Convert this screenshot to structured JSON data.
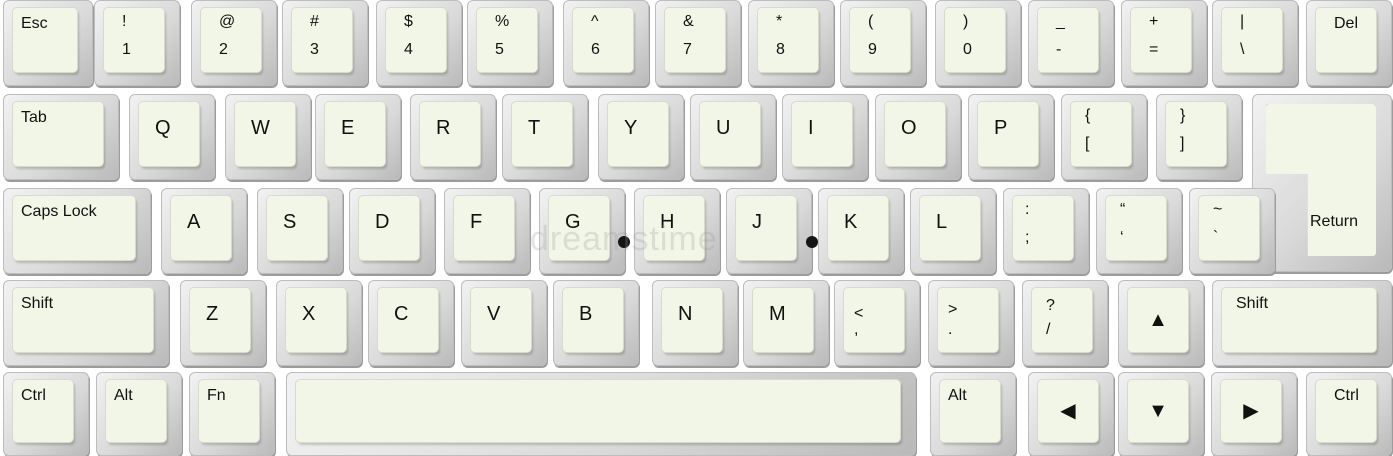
{
  "keys": {
    "esc": "Esc",
    "n1_top": "!",
    "n1_bot": "1",
    "n2_top": "@",
    "n2_bot": "2",
    "n3_top": "#",
    "n3_bot": "3",
    "n4_top": "$",
    "n4_bot": "4",
    "n5_top": "%",
    "n5_bot": "5",
    "n6_top": "^",
    "n6_bot": "6",
    "n7_top": "&",
    "n7_bot": "7",
    "n8_top": "*",
    "n8_bot": "8",
    "n9_top": "(",
    "n9_bot": "9",
    "n0_top": ")",
    "n0_bot": "0",
    "minus_top": "_",
    "minus_bot": "-",
    "equal_top": "+",
    "equal_bot": "=",
    "pipe_top": "|",
    "pipe_bot": "\\",
    "del": "Del",
    "tab": "Tab",
    "q": "Q",
    "w": "W",
    "e": "E",
    "r": "R",
    "t": "T",
    "y": "Y",
    "u": "U",
    "i": "I",
    "o": "O",
    "p": "P",
    "lbrace_top": "{",
    "lbrace_bot": "[",
    "rbrace_top": "}",
    "rbrace_bot": "]",
    "return": "Return",
    "caps": "Caps Lock",
    "a": "A",
    "s": "S",
    "d": "D",
    "f": "F",
    "g": "G",
    "h": "H",
    "j": "J",
    "k": "K",
    "l": "L",
    "semi_top": ":",
    "semi_bot": ";",
    "quote_top": "“",
    "quote_bot": "‘",
    "tilde_top": "~",
    "tilde_bot": "`",
    "shift_left": "Shift",
    "z": "Z",
    "x": "X",
    "c": "C",
    "v": "V",
    "b": "B",
    "n": "N",
    "m": "M",
    "lt_top": "<",
    "lt_bot": ",",
    "gt_top": ">",
    "gt_bot": ".",
    "q_top": "?",
    "q_bot": "/",
    "up_arrow": "▲",
    "shift_right": "Shift",
    "ctrl_left": "Ctrl",
    "alt_left": "Alt",
    "fn": "Fn",
    "alt_right": "Alt",
    "left_arrow": "◀",
    "down_arrow": "▼",
    "right_arrow": "▶",
    "ctrl_right": "Ctrl"
  },
  "watermark": "dreamstime"
}
